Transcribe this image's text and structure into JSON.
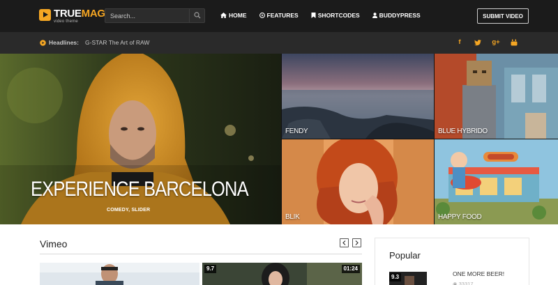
{
  "header": {
    "logo_title_a": "TRUE",
    "logo_title_b": "MAG",
    "logo_sub": "video theme",
    "search_placeholder": "Search...",
    "nav": [
      "HOME",
      "FEATURES",
      "SHORTCODES",
      "BUDDYPRESS"
    ],
    "submit_label": "SUBMIT VIDEO"
  },
  "headlines": {
    "label": "Headlines:",
    "text": "G-STAR The Art of RAW",
    "social": [
      "f",
      "t",
      "g+",
      "yt"
    ]
  },
  "hero": {
    "main_title": "EXPERIENCE BARCELONA",
    "main_meta": "COMEDY, SLIDER",
    "tiles": [
      "FENDY",
      "BLUE HYBRIDO",
      "BLIK",
      "HAPPY FOOD"
    ]
  },
  "vimeo": {
    "title": "Vimeo",
    "items": [
      {
        "rating": "",
        "duration": ""
      },
      {
        "rating": "9.7",
        "duration": "01:24"
      }
    ]
  },
  "popular": {
    "title": "Popular",
    "item_name": "ONE MORE BEER!",
    "item_rating": "9.3",
    "item_views": "33317"
  },
  "colors": {
    "accent": "#f5a623",
    "topbar": "#1b1b1b",
    "headbar": "#2a2a2a"
  }
}
